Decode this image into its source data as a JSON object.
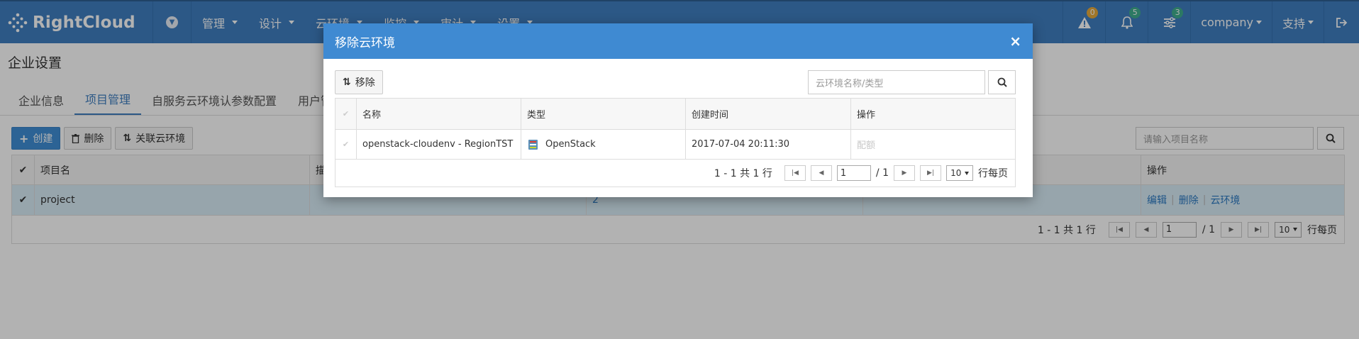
{
  "navbar": {
    "brand": "RightCloud",
    "menu": [
      "管理",
      "设计",
      "云环境",
      "监控",
      "审计",
      "设置"
    ],
    "right": {
      "alerts_count": "0",
      "notifications_count": "5",
      "settings_count": "3",
      "user": "company",
      "support": "支持"
    }
  },
  "page": {
    "title": "企业设置",
    "tabs": [
      "企业信息",
      "项目管理",
      "自服务云环境认参数配置",
      "用户管理"
    ],
    "toolbar": {
      "create": "创建",
      "delete": "删除",
      "link_cloud": "关联云环境"
    },
    "search_placeholder": "请输入项目名称",
    "grid": {
      "headers": {
        "project_name": "项目名",
        "description": "描述",
        "actions": "操作"
      },
      "row": {
        "name": "project",
        "count": "2",
        "actions": [
          "编辑",
          "删除",
          "云环境"
        ]
      },
      "pager": {
        "summary": "1 - 1 共 1 行",
        "page": "1",
        "total_pages": "/ 1",
        "page_size": "10",
        "per_page_label": "行每页"
      }
    }
  },
  "modal": {
    "title": "移除云环境",
    "toolbar": {
      "remove": "移除"
    },
    "search_placeholder": "云环境名称/类型",
    "headers": {
      "name": "名称",
      "type": "类型",
      "created": "创建时间",
      "actions": "操作"
    },
    "row": {
      "name": "openstack-cloudenv - RegionTST",
      "type": "OpenStack",
      "created": "2017-07-04 20:11:30",
      "action": "配额"
    },
    "pager": {
      "summary": "1 - 1 共 1 行",
      "page": "1",
      "total_pages": "/ 1",
      "page_size": "10",
      "per_page_label": "行每页"
    }
  },
  "colors": {
    "nav_bg": "#3f7fc0",
    "modal_header": "#3f8ad2",
    "primary_button": "#3f8fd6",
    "selected_row": "#d9ecf7",
    "link": "#2c7ac2"
  }
}
